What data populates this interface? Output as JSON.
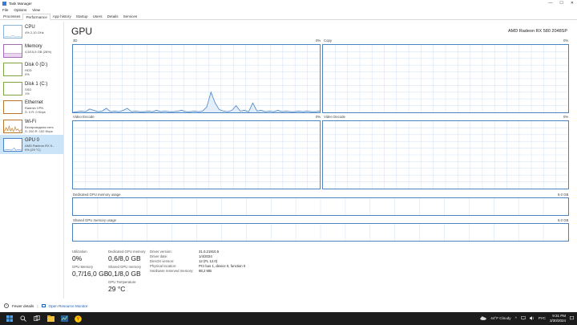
{
  "window": {
    "title": "Task Manager",
    "controls": [
      "—",
      "☐",
      "✕"
    ]
  },
  "menu": [
    "File",
    "Options",
    "View"
  ],
  "tabs": [
    {
      "label": "Processes",
      "active": false
    },
    {
      "label": "Performance",
      "active": true
    },
    {
      "label": "App history",
      "active": false
    },
    {
      "label": "Startup",
      "active": false
    },
    {
      "label": "Users",
      "active": false
    },
    {
      "label": "Details",
      "active": false
    },
    {
      "label": "Services",
      "active": false
    }
  ],
  "sidebar": [
    {
      "name": "CPU",
      "lines": [
        "4% 2,10 GHz"
      ],
      "kind": "cpu"
    },
    {
      "name": "Memory",
      "lines": [
        "4,5/15,9 GB (28%)"
      ],
      "kind": "mem"
    },
    {
      "name": "Disk 0 (D:)",
      "lines": [
        "HDD",
        "0%"
      ],
      "kind": "disk"
    },
    {
      "name": "Disk 1 (C:)",
      "lines": [
        "SSD",
        "1%"
      ],
      "kind": "disk"
    },
    {
      "name": "Ethernet",
      "lines": [
        "Radmin VPN",
        "S: 0 R: 0 Kbps"
      ],
      "kind": "eth"
    },
    {
      "name": "Wi-Fi",
      "lines": [
        "Беспроводная сеть",
        "S: 200 R: 152 Kbps"
      ],
      "kind": "wifi"
    },
    {
      "name": "GPU 0",
      "lines": [
        "AMD Radeon RX 5...",
        "0% (29 °C)"
      ],
      "kind": "gpu"
    }
  ],
  "gpu": {
    "title": "GPU",
    "model": "AMD Radeon RX 580 2048SP",
    "graphs": [
      {
        "name": "3D",
        "value": "0%"
      },
      {
        "name": "Copy",
        "value": "0%"
      },
      {
        "name": "Video Encode",
        "value": "0%"
      },
      {
        "name": "Video Decode",
        "value": "0%"
      }
    ],
    "dedicated": {
      "label": "Dedicated GPU memory usage",
      "max": "8,0 GB"
    },
    "shared": {
      "label": "Shared GPU memory usage",
      "max": "8,0 GB"
    },
    "stats": {
      "utilization": {
        "label": "Utilization",
        "value": "0%"
      },
      "dedicated_mem": {
        "label": "Dedicated GPU memory",
        "value": "0,6/8,0 GB"
      },
      "gpu_memory": {
        "label": "GPU Memory",
        "value": "0,7/16,0 GB"
      },
      "shared_mem": {
        "label": "Shared GPU memory",
        "value": "0,1/8,0 GB"
      },
      "temperature": {
        "label": "GPU Temperature",
        "value": "29 °C"
      }
    },
    "details": [
      {
        "label": "Driver version:",
        "value": "31.0.21910.5"
      },
      {
        "label": "Driver date:",
        "value": "1/4/2024"
      },
      {
        "label": "DirectX version:",
        "value": "12 (FL 12.0)"
      },
      {
        "label": "Physical location:",
        "value": "PCI bus 1, device 0, function 0"
      },
      {
        "label": "Hardware reserved memory:",
        "value": "98,2 MB"
      }
    ]
  },
  "footer": {
    "fewer_details": "Fewer details",
    "separator": "|",
    "resource_monitor": "Open Resource Monitor"
  },
  "taskbar": {
    "weather": "44°F Cloudy",
    "language": "РУС",
    "time": "9:31 PM",
    "date": "3/30/2024"
  },
  "colors": {
    "gpu_line": "#4a84c4",
    "grid": "#d7e6f4",
    "accent": "#cce4f7"
  },
  "chart_data": {
    "type": "line",
    "title": "3D",
    "ylim": [
      0,
      100
    ],
    "x": [
      0,
      1,
      2,
      3,
      4,
      5,
      6,
      7,
      8,
      9,
      10,
      11,
      12,
      13,
      14,
      15,
      16,
      17,
      18,
      19,
      20,
      21,
      22,
      23,
      24,
      25,
      26,
      27,
      28,
      29,
      30,
      31,
      32,
      33,
      34,
      35,
      36,
      37,
      38,
      39,
      40,
      41,
      42,
      43,
      44,
      45,
      46,
      47,
      48,
      49,
      50,
      51,
      52,
      53,
      54,
      55,
      56,
      57,
      58,
      59
    ],
    "series": [
      {
        "values": [
          0,
          1,
          2,
          1,
          5,
          3,
          1,
          2,
          6,
          1,
          2,
          1,
          3,
          6,
          1,
          2,
          1,
          1,
          2,
          1,
          3,
          1,
          2,
          1,
          1,
          2,
          3,
          1,
          1,
          2,
          1,
          2,
          8,
          30,
          14,
          4,
          2,
          1,
          3,
          10,
          2,
          3,
          1,
          14,
          2,
          3,
          1,
          2,
          1,
          3,
          1,
          2,
          1,
          1,
          2,
          1,
          2,
          1,
          1,
          2
        ]
      }
    ]
  }
}
